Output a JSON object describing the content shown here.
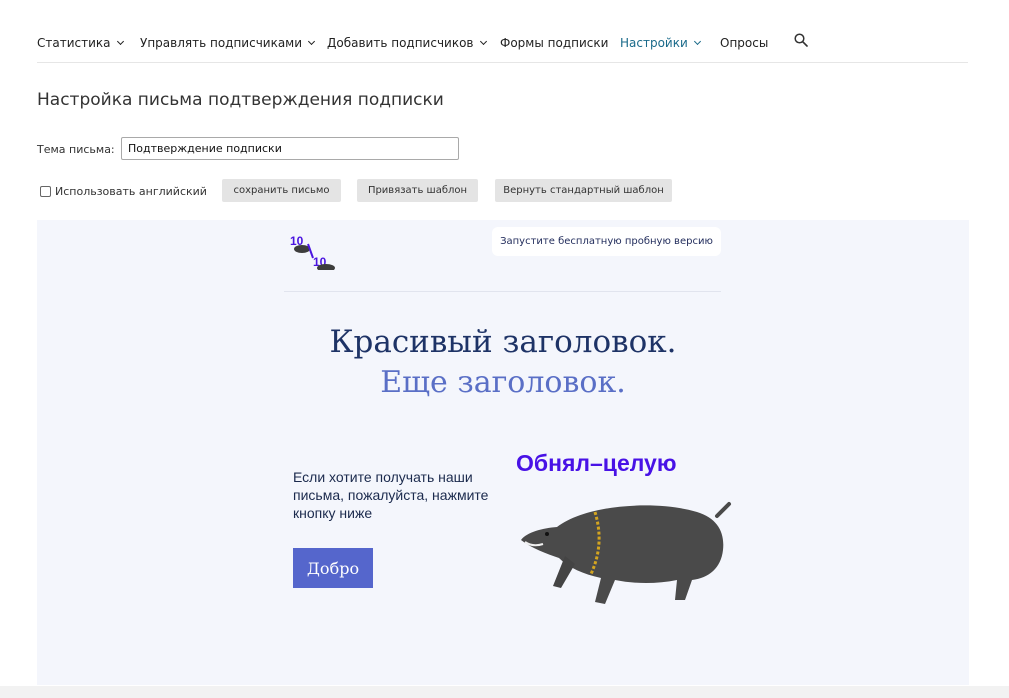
{
  "nav": {
    "items": [
      {
        "label": "Статистика",
        "dropdown": true
      },
      {
        "label": "Управлять подписчиками",
        "dropdown": true
      },
      {
        "label": "Добавить подписчиков",
        "dropdown": true
      },
      {
        "label": "Формы подписки",
        "dropdown": false
      },
      {
        "label": "Настройки",
        "dropdown": true,
        "active": true
      },
      {
        "label": "Опросы",
        "dropdown": false
      }
    ],
    "search_icon": "search-icon"
  },
  "page": {
    "title": "Настройка письма подтверждения подписки"
  },
  "form": {
    "subject_label": "Тема письма:",
    "subject_value": "Подтверждение подписки",
    "english_label": "Использовать английский",
    "english_checked": false,
    "save_label": "сохранить письмо",
    "bind_template_label": "Привязать шаблон",
    "restore_template_label": "Вернуть стандартный шаблон"
  },
  "preview": {
    "logo_top": "10",
    "logo_bottom": "10",
    "trial_label": "Запустите бесплатную пробную версию",
    "heading1": "Красивый заголовок.",
    "heading2": "Еще заголовок.",
    "body_text": "Если хотите получать наши письма, пожалуйста, нажмите кнопку ниже",
    "agree_label": "Добро",
    "promo_caption": "Обнял–целую"
  },
  "colors": {
    "active_nav": "#1a6a8a",
    "preview_bg": "#f4f6fc",
    "heading1": "#1e3366",
    "heading2": "#5a6fc6",
    "button": "#5566cc",
    "promo": "#4812e6"
  }
}
